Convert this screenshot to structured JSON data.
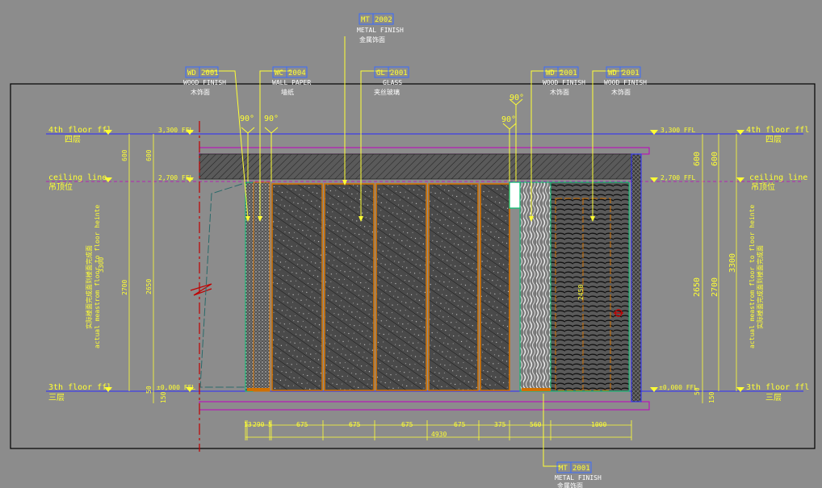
{
  "tags": {
    "mt2002": {
      "code": "MT",
      "num": "2002",
      "en": "METAL FINISH",
      "cn": "金属饰面"
    },
    "wd2001_l": {
      "code": "WD",
      "num": "2001",
      "en": "WOOD FINISH",
      "cn": "木饰面"
    },
    "wc2004": {
      "code": "WC",
      "num": "2004",
      "en": "WALL PAPER",
      "cn": "墙纸"
    },
    "gl2001": {
      "code": "GL",
      "num": "2001",
      "en": "GLASS",
      "cn": "夹丝玻璃"
    },
    "wd2001_m": {
      "code": "WD",
      "num": "2001",
      "en": "WOOD FINISH",
      "cn": "木饰面"
    },
    "wd2001_r": {
      "code": "WD",
      "num": "2001",
      "en": "WOOD FINISH",
      "cn": "木饰面"
    },
    "mt2001": {
      "code": "MT",
      "num": "2001",
      "en": "METAL FINISH",
      "cn": "金属饰面"
    }
  },
  "angles": {
    "a1": "90°",
    "a2": "90°",
    "a3": "90°",
    "a4": "90°"
  },
  "levels_left": {
    "fourth_en": "4th floor ffl",
    "fourth_cn": "四层",
    "ceiling_en": "ceiling line",
    "ceiling_cn": "吊顶位",
    "third_en": "3th floor ffl",
    "third_cn": "三层",
    "ffl_3300": "3,300 FFL",
    "ffl_2700": "2,700 FFL",
    "ffl_0": "±0,000 FFL"
  },
  "levels_right": {
    "fourth_en": "4th floor ffl",
    "fourth_cn": "四层",
    "ceiling_en": "ceiling line",
    "ceiling_cn": "吊顶位",
    "third_en": "3th floor ffl",
    "third_cn": "三层",
    "ffl_3300": "3,300 FFL",
    "ffl_2700": "2,700 FFL",
    "ffl_0": "±0,000 FFL"
  },
  "dims_left": {
    "d600a": "600",
    "d600b": "600",
    "d3300": "3300",
    "d2700": "2700",
    "d2650": "2650",
    "d50": "50",
    "d150": "150"
  },
  "dims_right": {
    "d600a": "600",
    "d600b": "600",
    "d3300": "3300",
    "d2700": "2700",
    "d2650": "2650",
    "d50": "50",
    "d150": "150"
  },
  "side_note": {
    "cn": "实际楼面完成面到楼面完成面",
    "en": "actual meastrom floor to floor heinte"
  },
  "inner_dim": "2450",
  "bottom_dims": [
    "13",
    "290",
    "5",
    "675",
    "675",
    "675",
    "675",
    "375",
    "560",
    "1000"
  ],
  "total_dim": "4930",
  "colors": {
    "background": "#8c8c8c",
    "frame": "#000000",
    "annotation": "#ffff33",
    "level_line": "#2a2aff",
    "slab": "#c000c0",
    "panel_outline": "#d07000",
    "wood_edge": "#00c070",
    "tag_box": "#3a6cff",
    "section_cut": "#c00000"
  }
}
